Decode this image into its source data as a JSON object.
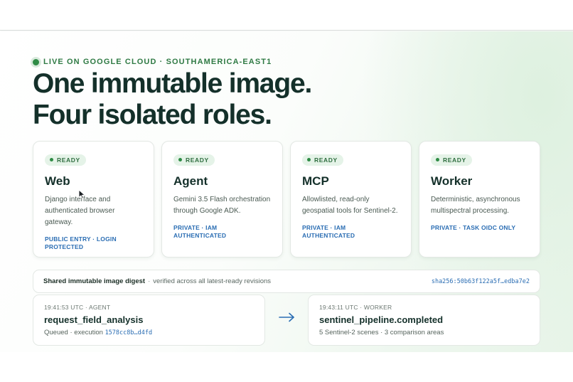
{
  "hero": {
    "eyebrow": "LIVE ON GOOGLE CLOUD · SOUTHAMERICA-EAST1",
    "headline_line1": "One immutable image.",
    "headline_line2": "Four isolated roles."
  },
  "roles": [
    {
      "badge": "READY",
      "title": "Web",
      "description": "Django interface and authenticated browser gateway.",
      "access": "PUBLIC ENTRY · LOGIN PROTECTED"
    },
    {
      "badge": "READY",
      "title": "Agent",
      "description": "Gemini 3.5 Flash orchestration through Google ADK.",
      "access": "PRIVATE · IAM AUTHENTICATED"
    },
    {
      "badge": "READY",
      "title": "MCP",
      "description": "Allowlisted, read-only geospatial tools for Sentinel-2.",
      "access": "PRIVATE · IAM AUTHENTICATED"
    },
    {
      "badge": "READY",
      "title": "Worker",
      "description": "Deterministic, asynchronous multispectral processing.",
      "access": "PRIVATE · TASK OIDC ONLY"
    }
  ],
  "digest": {
    "label": "Shared immutable image digest",
    "separator": "·",
    "note": "verified across all latest-ready revisions",
    "hash": "sha256:50b63f122a5f…edba7e2"
  },
  "events": {
    "agent": {
      "meta": "19:41:53 UTC · AGENT",
      "name": "request_field_analysis",
      "detail_prefix": "Queued · execution",
      "execution_id": "1578cc8b…d4fd"
    },
    "worker": {
      "meta": "19:43:11 UTC · WORKER",
      "name": "sentinel_pipeline.completed",
      "detail": "5 Sentinel-2 scenes · 3 comparison areas"
    }
  },
  "colors": {
    "accent_green": "#2e8b45",
    "link_blue": "#2a6db3",
    "heading": "#14302a"
  },
  "icons": {
    "status_dot": "green-dot",
    "flow_arrow": "arrow-right-icon",
    "pointer": "mouse-cursor-icon"
  }
}
